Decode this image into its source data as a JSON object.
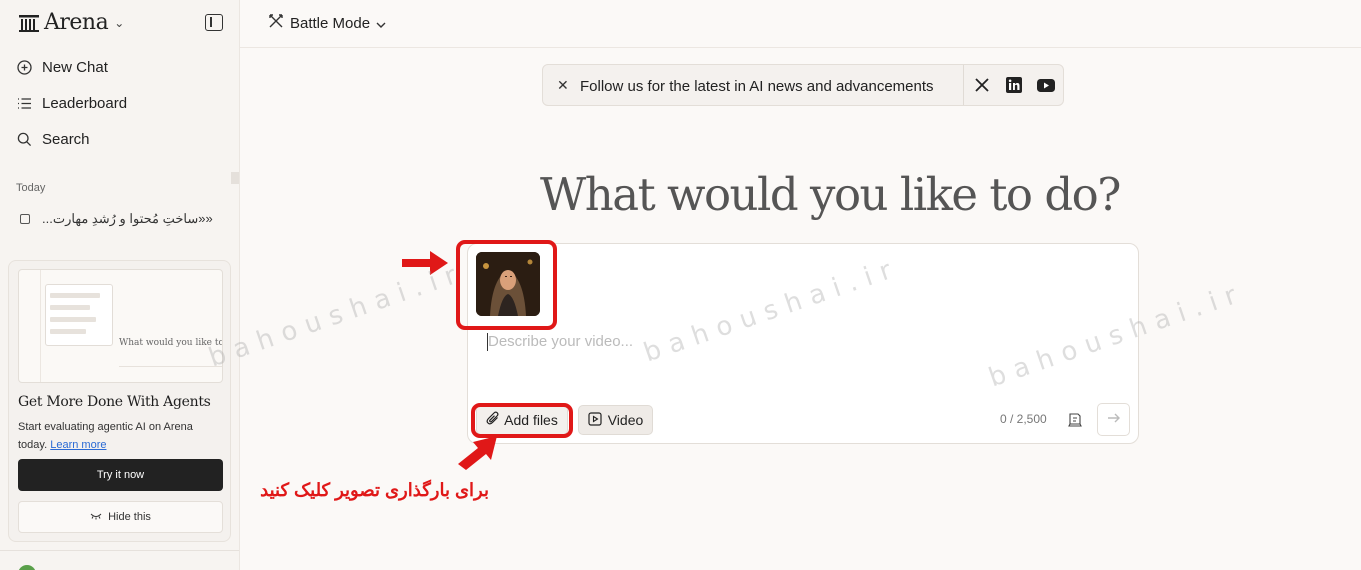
{
  "sidebar": {
    "brand": "Arena",
    "nav": [
      {
        "label": "New Chat",
        "icon": "plus-circle-icon"
      },
      {
        "label": "Leaderboard",
        "icon": "list-icon"
      },
      {
        "label": "Search",
        "icon": "search-icon"
      }
    ],
    "section_label": "Today",
    "history": [
      {
        "label": "...ساختِ مُحتوا و رُشدِ مهارت»»"
      }
    ],
    "promo": {
      "preview_text": "What would you like to",
      "title": "Get More Done With Agents",
      "description": "Start evaluating agentic AI on Arena today.",
      "link": "Learn more",
      "primary": "Try it now",
      "secondary": "Hide this"
    }
  },
  "topbar": {
    "mode_label": "Battle Mode"
  },
  "banner": {
    "message": "Follow us for the latest in AI news and advancements",
    "socials": [
      "x-icon",
      "linkedin-icon",
      "youtube-icon"
    ]
  },
  "main": {
    "headline": "What would you like to do?",
    "composer": {
      "placeholder": "Describe your video...",
      "add_files": "Add files",
      "video": "Video",
      "counter": "0 / 2,500"
    }
  },
  "annotation": {
    "instruction": "برای بارگذاری تصویر کلیک کنید",
    "color": "#e01818"
  },
  "watermark": "bahoushai.ir"
}
